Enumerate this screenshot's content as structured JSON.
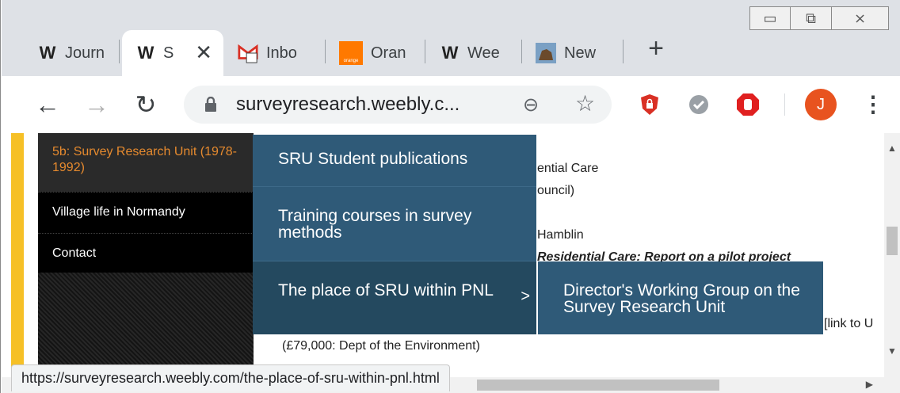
{
  "tabs": [
    {
      "title": "Journ",
      "icon": "weebly-icon"
    },
    {
      "title": "S",
      "icon": "weebly-icon",
      "active": true
    },
    {
      "title": "Inbo",
      "icon": "gmail-icon",
      "badge": "0"
    },
    {
      "title": "Oran",
      "icon": "orange-icon",
      "icon_text": "orange"
    },
    {
      "title": "Wee",
      "icon": "weebly-icon"
    },
    {
      "title": "New",
      "icon": "dog-icon"
    }
  ],
  "favicon_letter": "W",
  "toolbar": {
    "url": "surveyresearch.weebly.c...",
    "avatar_letter": "J"
  },
  "colors": {
    "nav_active": "#e68a2e",
    "dropdown_bg": "#2f5a78",
    "avatar": "#e8531f"
  },
  "sidebar": {
    "items": [
      {
        "label": "5b: Survey Research Unit (1978-1992)",
        "current": true
      },
      {
        "label": "Village life in Normandy"
      },
      {
        "label": "Contact"
      }
    ]
  },
  "dropdown": {
    "items": [
      {
        "label": "SRU Student publications"
      },
      {
        "label": "Training courses in survey methods"
      },
      {
        "label": "The place of SRU within PNL",
        "has_submenu": true,
        "arrow": ">"
      }
    ],
    "submenu": [
      "Director's Working Group on the Survey Research Unit"
    ]
  },
  "content": {
    "line1": "ential Care",
    "line2": "ouncil)",
    "line3": "Hamblin",
    "line4": "Residential Care: Report on a pilot project",
    "line5": "[link to U",
    "line6": "(£79,000: Dept of the Environment)"
  },
  "status_url": "https://surveyresearch.weebly.com/the-place-of-sru-within-pnl.html"
}
